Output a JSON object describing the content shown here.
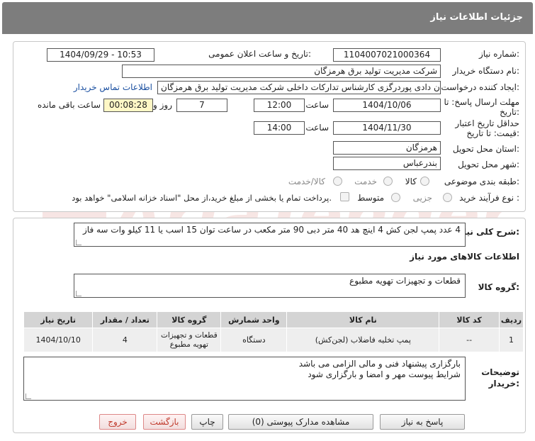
{
  "header": {
    "title": "جزئیات اطلاعات نیاز"
  },
  "form": {
    "need_number_label": "شماره نیاز:",
    "need_number": "1104007021000364",
    "announce_label": "تاریخ و ساعت اعلان عمومی:",
    "announce_value": "1404/09/29 - 10:53",
    "buyer_org_label": "نام دستگاه خریدار:",
    "buyer_org": "شرکت مدیریت تولید برق هرمزگان",
    "requester_label": "ایجاد کننده درخواست:",
    "requester": "پیمان دادی پوردرگزی کارشناس تدارکات داخلی شرکت مدیریت تولید برق هرمزگان",
    "contact_link": "اطلاعات تماس خریدار",
    "deadline_label_1": "مهلت ارسال پاسخ: تا",
    "deadline_label_2": "تاریخ:",
    "deadline_date": "1404/10/06",
    "time_label": "ساعت",
    "deadline_time": "12:00",
    "days_value": "7",
    "days_label": "روز و",
    "remaining_time": "00:08:28",
    "remaining_label": "ساعت باقی مانده",
    "validity_label_1": "حداقل تاریخ اعتبار",
    "validity_label_2": "قیمت: تا تاریخ:",
    "validity_date": "1404/11/30",
    "validity_time": "14:00",
    "province_label": "استان محل تحویل:",
    "province": "هرمزگان",
    "city_label": "شهر محل تحویل:",
    "city": "بندرعباس",
    "category_label": "طبقه بندی موضوعی:",
    "category_options": [
      "کالا",
      "خدمت",
      "کالا/خدمت"
    ],
    "process_label": "نوع فرآیند خرید :",
    "process_options": [
      "جزیی",
      "متوسط"
    ],
    "payment_note": "پرداخت تمام یا بخشی از مبلغ خرید،از محل \"اسناد خزانه اسلامی\" خواهد بود."
  },
  "summary": {
    "label": "شرح کلی نیاز:",
    "text": "4 عدد پمپ لجن کش 4 اینچ هد 40 متر دبی 90 متر مکعب در ساعت توان 15 اسب یا 11 کیلو وات سه فاز"
  },
  "goods_info": {
    "title": "اطلاعات کالاهای مورد نیاز",
    "group_label": "گروه کالا:",
    "group_value": "قطعات و تجهیزات تهویه مطبوع"
  },
  "table": {
    "headers": [
      "ردیف",
      "کد کالا",
      "نام کالا",
      "واحد شمارش",
      "گروه کالا",
      "تعداد / مقدار",
      "تاریخ نیاز"
    ],
    "rows": [
      [
        "1",
        "--",
        "پمپ تخلیه فاضلاب (لجن‌کش)",
        "دستگاه",
        "قطعات و تجهیزات تهویه مطبوع",
        "4",
        "1404/10/10"
      ]
    ]
  },
  "notes": {
    "label_1": "توضیحات",
    "label_2": "خریدار:",
    "line_1": "بارگزاری پیشنهاد فنی و مالی الزامی می باشد",
    "line_2": "شرایط پیوست مهر و امضا و بارگزاری شود"
  },
  "buttons": {
    "reply": "پاسخ به نیاز",
    "attachments": "مشاهده مدارک پیوستی (0)",
    "print": "چاپ",
    "back": "بازگشت",
    "exit": "خروج"
  },
  "watermark": {
    "text": "AriaTender.net"
  },
  "colors": {
    "header_bg": "#7d7d7d",
    "table_header_bg": "#d4d4d4",
    "remaining_bg": "#fff7c6",
    "link": "#1a4fa0"
  }
}
